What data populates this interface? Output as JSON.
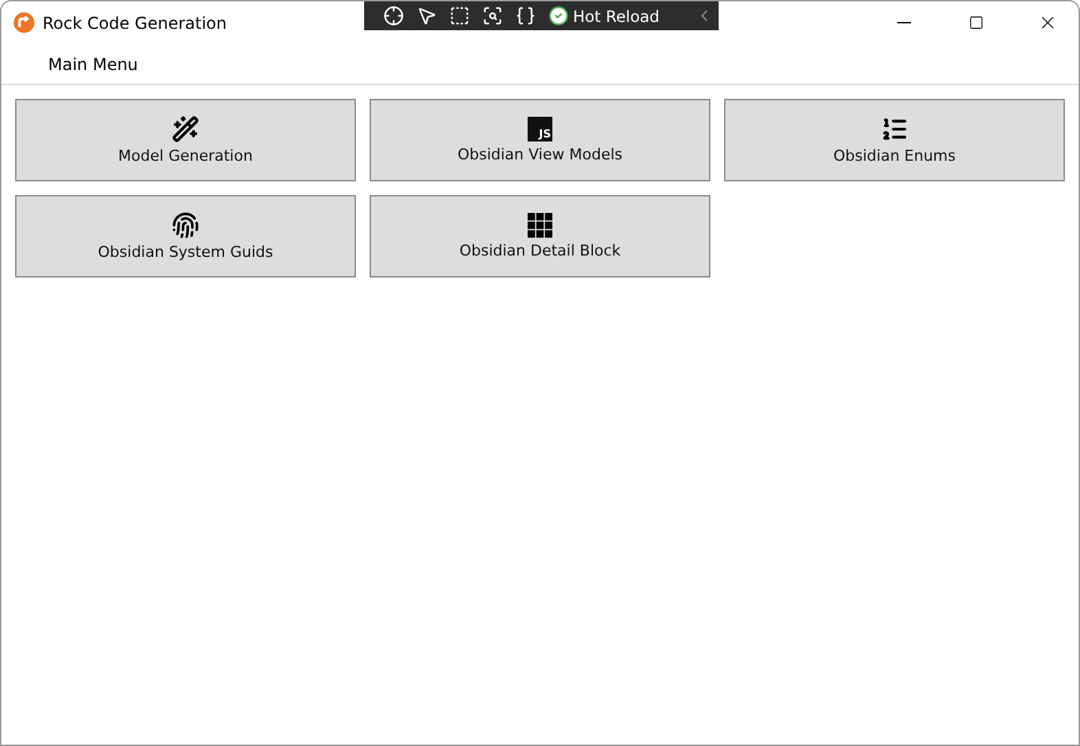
{
  "window": {
    "title": "Rock Code Generation"
  },
  "debug_toolbar": {
    "label": "Hot Reload"
  },
  "menu": {
    "label": "Main Menu"
  },
  "tiles": [
    {
      "kind": "wand",
      "label": "Model Generation"
    },
    {
      "kind": "js",
      "icon_text": "JS",
      "label": "Obsidian View Models"
    },
    {
      "kind": "list",
      "label": "Obsidian Enums"
    },
    {
      "kind": "fingerprint",
      "label": "Obsidian System Guids"
    },
    {
      "kind": "grid",
      "label": "Obsidian Detail Block"
    }
  ]
}
